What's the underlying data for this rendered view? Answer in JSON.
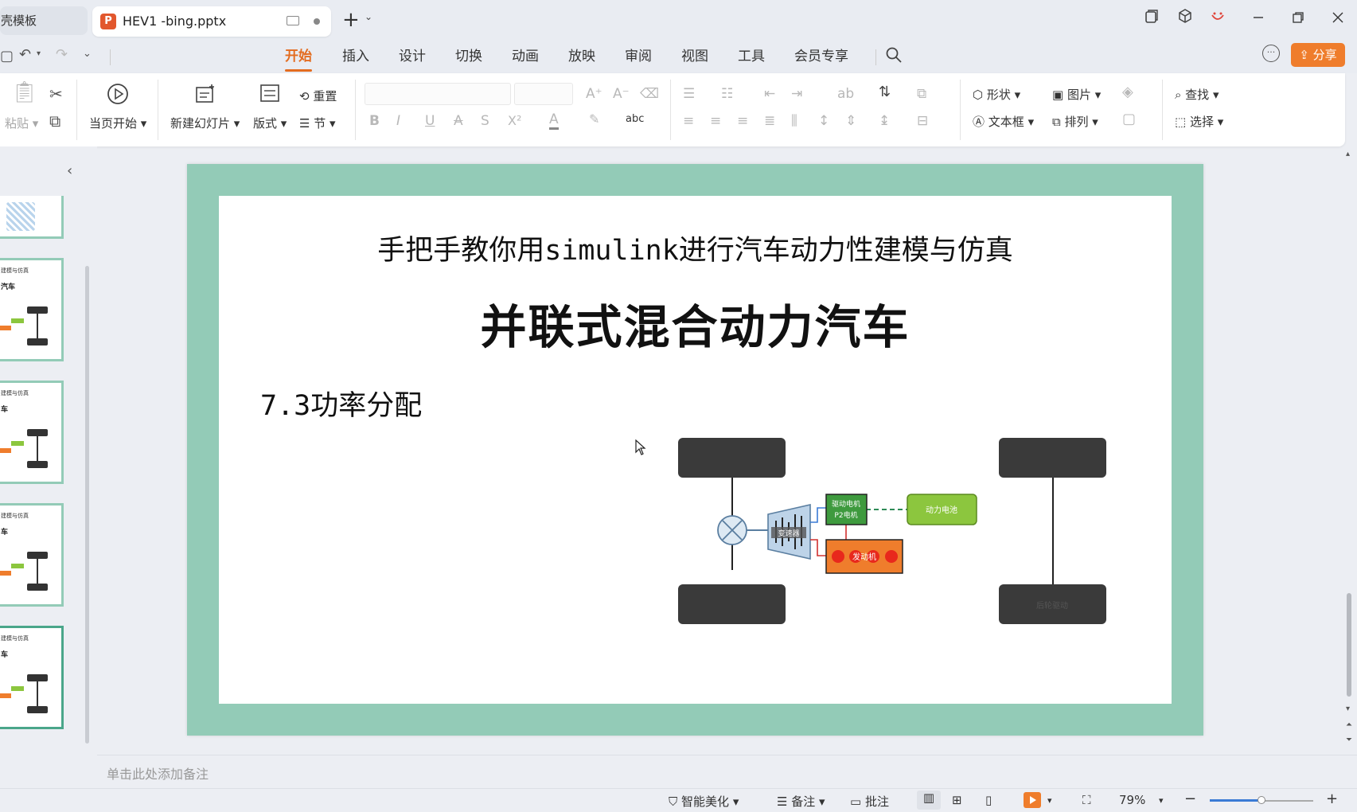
{
  "tabs": {
    "inactive_label": "稻壳模板",
    "active_label": "HEV1 -bing.pptx",
    "app_icon_letter": "P"
  },
  "menu": {
    "items": [
      "开始",
      "插入",
      "设计",
      "切换",
      "动画",
      "放映",
      "审阅",
      "视图",
      "工具",
      "会员专享"
    ],
    "active_index": 0,
    "share_label": "分享"
  },
  "ribbon": {
    "paste": "粘贴",
    "from_current": "当页开始",
    "new_slide": "新建幻灯片",
    "layout": "版式",
    "reset": "重置",
    "section": "节",
    "shape": "形状",
    "picture": "图片",
    "find": "查找",
    "textbox": "文本框",
    "arrange": "排列",
    "select": "选择",
    "font_buttons": [
      "B",
      "I",
      "U",
      "A",
      "S",
      "X²",
      "A"
    ],
    "pinyin_icon": "abc"
  },
  "slide": {
    "subtitle": "手把手教你用simulink进行汽车动力性建模与仿真",
    "title": "并联式混合动力汽车",
    "section": "7.3功率分配",
    "diagram": {
      "gearbox_label": "变速器",
      "motor_label_1": "驱动电机",
      "motor_label_2": "P2电机",
      "battery_label": "动力电池",
      "engine_label": "发动机",
      "wheel_label": "后轮驱动"
    }
  },
  "thumbnails": {
    "thumb_title": "建模与仿真",
    "thumb_sub": "汽车",
    "thumb_sub_short": "车"
  },
  "notes": {
    "placeholder": "单击此处添加备注"
  },
  "status": {
    "smart_beautify": "智能美化",
    "notes": "备注",
    "comment": "批注",
    "zoom": "79%",
    "zoom_fraction": 0.5
  },
  "colors": {
    "accent": "#e36c20",
    "slide_frame": "#93cbb7",
    "share_button": "#ef7d2c",
    "battery": "#8cc63e",
    "engine": "#ef7d2c",
    "wheel": "#3a3a3a"
  }
}
